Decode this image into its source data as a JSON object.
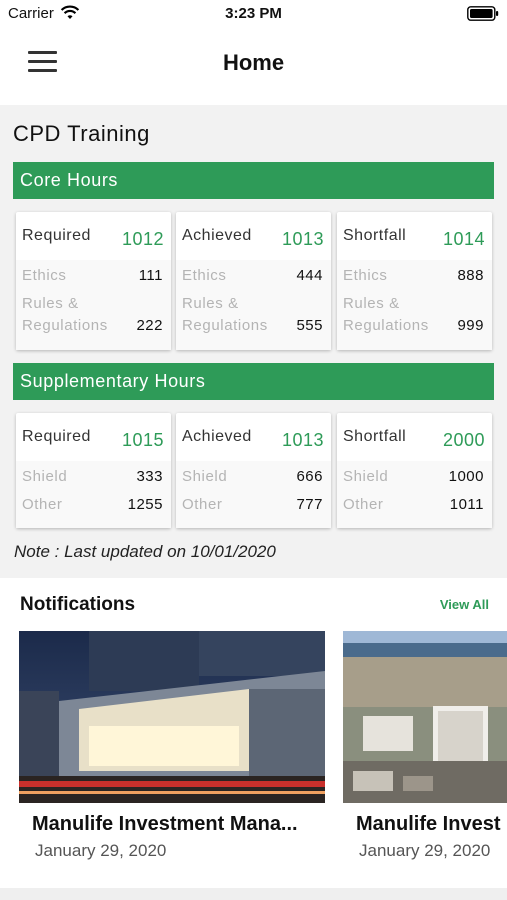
{
  "status_bar": {
    "carrier": "Carrier",
    "time": "3:23 PM"
  },
  "nav": {
    "title": "Home"
  },
  "cpd": {
    "title": "CPD Training",
    "core": {
      "heading": "Core Hours",
      "cards": [
        {
          "label": "Required",
          "total": "1012",
          "rows": [
            {
              "label": "Ethics",
              "value": "111"
            },
            {
              "label": "Rules &",
              "label2": "Regulations",
              "value": "222"
            }
          ]
        },
        {
          "label": "Achieved",
          "total": "1013",
          "rows": [
            {
              "label": "Ethics",
              "value": "444"
            },
            {
              "label": "Rules &",
              "label2": "Regulations",
              "value": "555"
            }
          ]
        },
        {
          "label": "Shortfall",
          "total": "1014",
          "rows": [
            {
              "label": "Ethics",
              "value": "888"
            },
            {
              "label": "Rules &",
              "label2": "Regulations",
              "value": "999"
            }
          ]
        }
      ]
    },
    "supplementary": {
      "heading": "Supplementary Hours",
      "cards": [
        {
          "label": "Required",
          "total": "1015",
          "rows": [
            {
              "label": "Shield",
              "value": "333"
            },
            {
              "label": "Other",
              "value": "1255"
            }
          ]
        },
        {
          "label": "Achieved",
          "total": "1013",
          "rows": [
            {
              "label": "Shield",
              "value": "666"
            },
            {
              "label": "Other",
              "value": "777"
            }
          ]
        },
        {
          "label": "Shortfall",
          "total": "2000",
          "rows": [
            {
              "label": "Shield",
              "value": "1000"
            },
            {
              "label": "Other",
              "value": "1011"
            }
          ]
        }
      ]
    },
    "note": "Note : Last updated on 10/01/2020"
  },
  "notifications": {
    "title": "Notifications",
    "view_all": "View All",
    "items": [
      {
        "headline": "Manulife Investment Mana...",
        "date": "January 29, 2020"
      },
      {
        "headline": "Manulife Invest",
        "date": "January 29, 2020"
      }
    ]
  },
  "colors": {
    "accent": "#2e9b58",
    "background": "#f2f2f2"
  }
}
